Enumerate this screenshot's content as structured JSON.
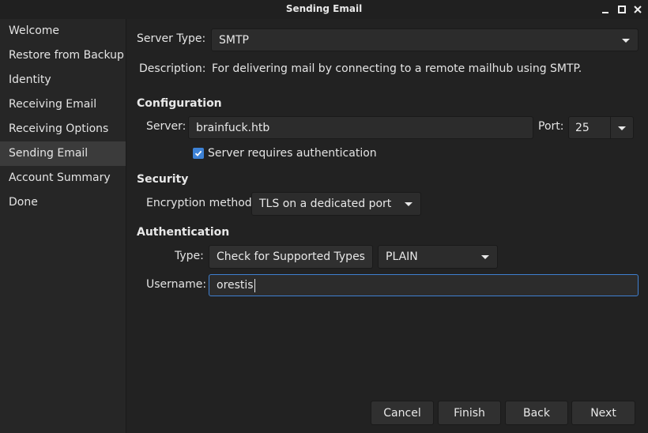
{
  "window": {
    "title": "Sending Email"
  },
  "sidebar": {
    "items": [
      {
        "label": "Welcome"
      },
      {
        "label": "Restore from Backup"
      },
      {
        "label": "Identity"
      },
      {
        "label": "Receiving Email"
      },
      {
        "label": "Receiving Options"
      },
      {
        "label": "Sending Email",
        "active": true
      },
      {
        "label": "Account Summary"
      },
      {
        "label": "Done"
      }
    ]
  },
  "server_type": {
    "label": "Server Type:",
    "value": "SMTP"
  },
  "description": {
    "label": "Description:",
    "text": "For delivering mail by connecting to a remote mailhub using SMTP."
  },
  "configuration": {
    "heading": "Configuration",
    "server_label": "Server:",
    "server_value": "brainfuck.htb",
    "port_label": "Port:",
    "port_value": "25",
    "auth_required_label": "Server requires authentication",
    "auth_required_checked": true
  },
  "security": {
    "heading": "Security",
    "encryption_label": "Encryption method:",
    "encryption_value": "TLS on a dedicated port"
  },
  "authentication": {
    "heading": "Authentication",
    "type_label": "Type:",
    "check_button": "Check for Supported Types",
    "type_value": "PLAIN",
    "username_label": "Username:",
    "username_value": "orestis"
  },
  "footer": {
    "cancel": "Cancel",
    "finish": "Finish",
    "back": "Back",
    "next": "Next"
  },
  "colors": {
    "accent": "#3d82d6",
    "focus_border": "#3f7fd0",
    "background": "#222222"
  }
}
